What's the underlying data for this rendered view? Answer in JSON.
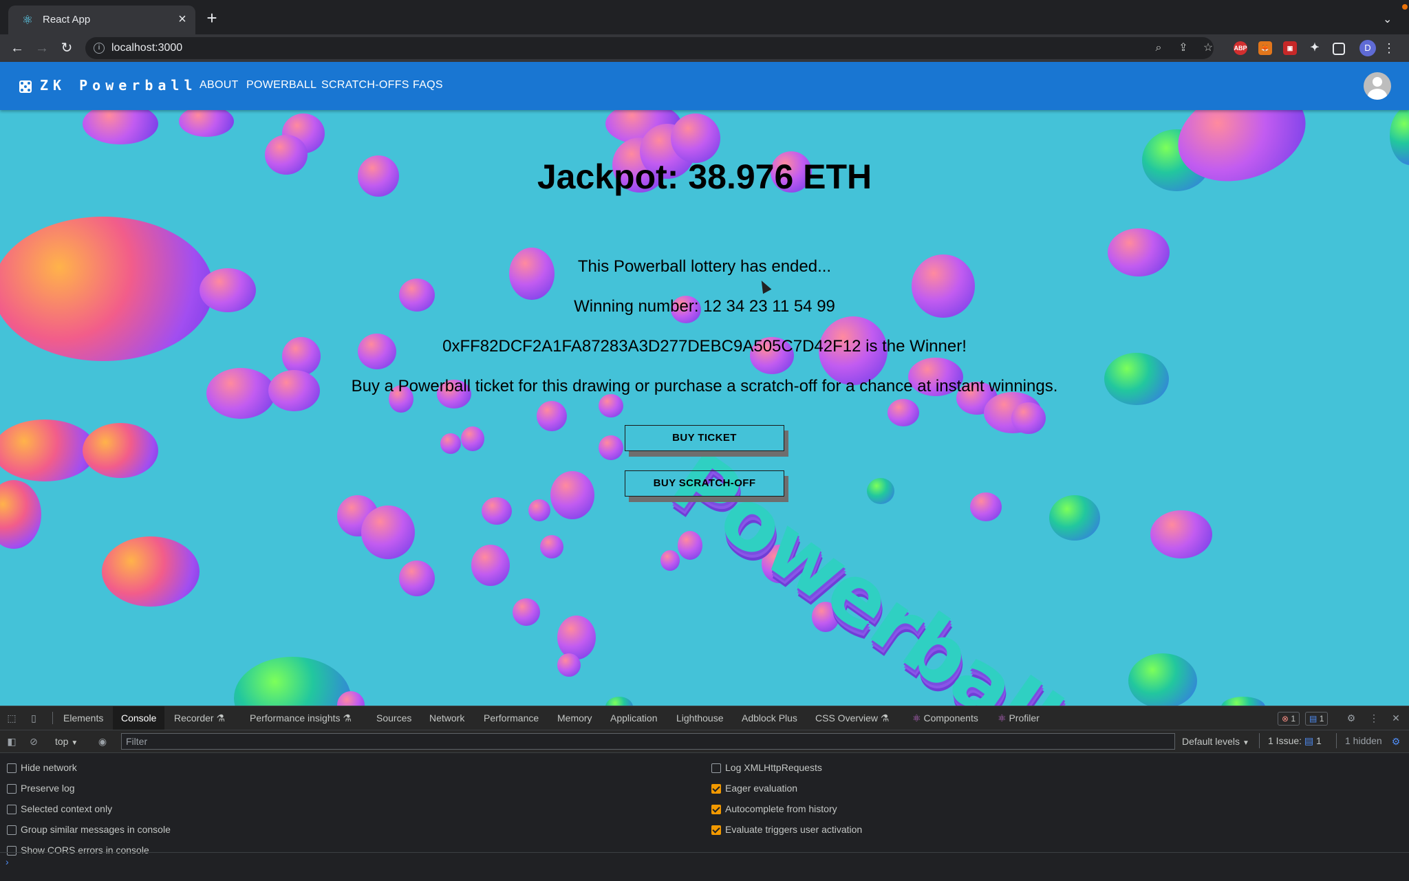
{
  "browser": {
    "tab_title": "React App",
    "url": "localhost:3000",
    "profile_initial": "D",
    "ext_abp": "ABP"
  },
  "app": {
    "brand": "ZK Powerball",
    "nav": [
      "ABOUT",
      "POWERBALL",
      "SCRATCH-OFFS",
      "FAQS"
    ]
  },
  "main": {
    "jackpot": "Jackpot: 38.976 ETH",
    "ended": "This Powerball lottery has ended...",
    "winning_number": "Winning number: 12 34 23 11 54 99",
    "winner": "0xFF82DCF2A1FA87283A3D277DEBC9A505C7D42F12 is the Winner!",
    "cta_text": "Buy a Powerball ticket for this drawing or purchase a scratch-off for a chance at instant winnings.",
    "buy_ticket": "BUY TICKET",
    "buy_scratch": "BUY SCRATCH-OFF",
    "scene_text": "Powerball"
  },
  "devtools": {
    "tabs": [
      "Elements",
      "Console",
      "Recorder",
      "Performance insights",
      "Sources",
      "Network",
      "Performance",
      "Memory",
      "Application",
      "Lighthouse",
      "Adblock Plus",
      "CSS Overview",
      "Components",
      "Profiler"
    ],
    "errors_count": "1",
    "messages_count": "1",
    "context": "top",
    "filter_placeholder": "Filter",
    "levels": "Default levels",
    "issues": "1 Issue:",
    "issues_count": "1",
    "hidden": "1 hidden",
    "settings_left": [
      {
        "label": "Hide network",
        "checked": false
      },
      {
        "label": "Preserve log",
        "checked": false
      },
      {
        "label": "Selected context only",
        "checked": false
      },
      {
        "label": "Group similar messages in console",
        "checked": false
      },
      {
        "label": "Show CORS errors in console",
        "checked": false
      }
    ],
    "settings_right": [
      {
        "label": "Log XMLHttpRequests",
        "checked": false
      },
      {
        "label": "Eager evaluation",
        "checked": true
      },
      {
        "label": "Autocomplete from history",
        "checked": true
      },
      {
        "label": "Evaluate triggers user activation",
        "checked": true
      }
    ]
  }
}
